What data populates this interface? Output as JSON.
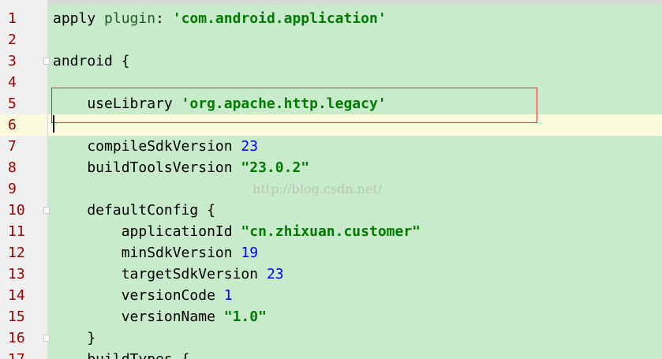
{
  "editor": {
    "watermark": "http://blog.csdn.net/",
    "lines": [
      {
        "num": "1",
        "tokens": [
          [
            "p",
            "apply "
          ],
          [
            "k",
            "plugin"
          ],
          [
            "p",
            ": "
          ],
          [
            "s",
            "'com.android.application'"
          ]
        ]
      },
      {
        "num": "2",
        "tokens": []
      },
      {
        "num": "3",
        "tokens": [
          [
            "p",
            "android {"
          ]
        ],
        "fold": true
      },
      {
        "num": "4",
        "tokens": []
      },
      {
        "num": "5",
        "tokens": [
          [
            "p",
            "    useLibrary "
          ],
          [
            "s",
            "'org.apache.http.legacy'"
          ]
        ]
      },
      {
        "num": "6",
        "tokens": [],
        "current": true
      },
      {
        "num": "7",
        "tokens": [
          [
            "p",
            "    compileSdkVersion "
          ],
          [
            "n",
            "23"
          ]
        ]
      },
      {
        "num": "8",
        "tokens": [
          [
            "p",
            "    buildToolsVersion "
          ],
          [
            "s",
            "\"23.0.2\""
          ]
        ]
      },
      {
        "num": "9",
        "tokens": []
      },
      {
        "num": "10",
        "tokens": [
          [
            "p",
            "    defaultConfig {"
          ]
        ],
        "fold": true
      },
      {
        "num": "11",
        "tokens": [
          [
            "p",
            "        applicationId "
          ],
          [
            "s",
            "\"cn.zhixuan.customer\""
          ]
        ]
      },
      {
        "num": "12",
        "tokens": [
          [
            "p",
            "        minSdkVersion "
          ],
          [
            "n",
            "19"
          ]
        ]
      },
      {
        "num": "13",
        "tokens": [
          [
            "p",
            "        targetSdkVersion "
          ],
          [
            "n",
            "23"
          ]
        ]
      },
      {
        "num": "14",
        "tokens": [
          [
            "p",
            "        versionCode "
          ],
          [
            "n",
            "1"
          ]
        ]
      },
      {
        "num": "15",
        "tokens": [
          [
            "p",
            "        versionName "
          ],
          [
            "s",
            "\"1.0\""
          ]
        ]
      },
      {
        "num": "16",
        "tokens": [
          [
            "p",
            "    }"
          ]
        ],
        "fold": true
      },
      {
        "num": "17",
        "tokens": [
          [
            "p",
            "    buildTypes {"
          ]
        ]
      }
    ]
  }
}
